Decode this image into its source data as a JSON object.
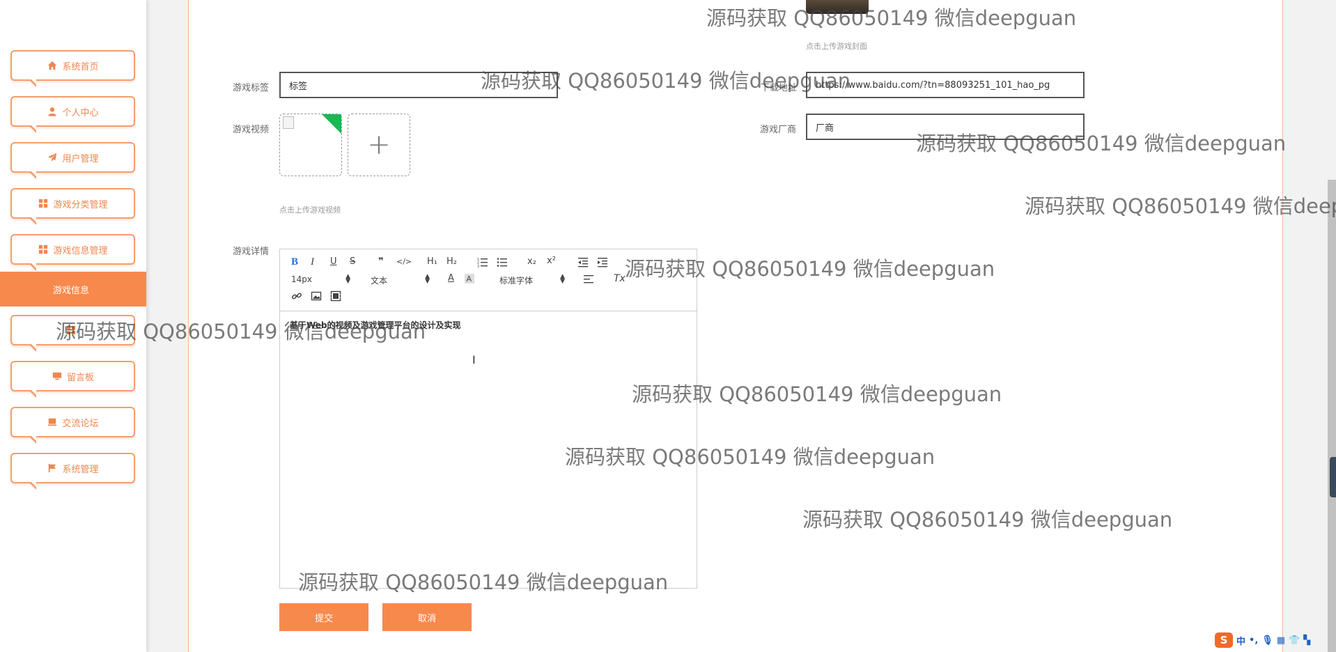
{
  "sidebar": {
    "items": [
      {
        "label": "系统首页",
        "icon": "home-icon"
      },
      {
        "label": "个人中心",
        "icon": "user-icon"
      },
      {
        "label": "用户管理",
        "icon": "send-icon"
      },
      {
        "label": "游戏分类管理",
        "icon": "grid-icon"
      },
      {
        "label": "游戏信息管理",
        "icon": "grid-icon"
      },
      {
        "label": "留言板",
        "icon": "monitor-icon"
      },
      {
        "label": "交流论坛",
        "icon": "monitor-icon"
      },
      {
        "label": "系统管理",
        "icon": "flag-icon"
      }
    ],
    "active_item": "游戏信息"
  },
  "form": {
    "cover_hint": "点击上传游戏封面",
    "tag_label": "游戏标签",
    "tag_value": "标签",
    "download_label": "下载地址",
    "download_value": "https://www.baidu.com/?tn=88093251_101_hao_pg",
    "video_label": "游戏视频",
    "vendor_label": "游戏厂商",
    "vendor_value": "厂商",
    "video_hint": "点击上传游戏视频",
    "plus_symbol": "+",
    "detail_label": "游戏详情",
    "submit_label": "提交",
    "cancel_label": "取消"
  },
  "editor": {
    "font_size": "14px",
    "paragraph": "文本",
    "font_family": "标准字体",
    "content": "基于Web的视频及游戏管理平台的设计及实现",
    "buttons": {
      "bold": "B",
      "italic": "I",
      "underline": "U",
      "strike": "S",
      "quote": "❞",
      "code": "</>",
      "h1": "H₁",
      "h2": "H₂",
      "subscript": "x₂",
      "superscript": "x²",
      "font_color": "A",
      "clean": "Tx"
    }
  },
  "watermark": "源码获取 QQ86050149 微信deepguan",
  "tray": {
    "ime_logo": "S",
    "ime_lang": "中"
  },
  "colors": {
    "accent": "#f7894d",
    "accent_border": "#f79c6c",
    "corner_green": "#1bb855"
  }
}
